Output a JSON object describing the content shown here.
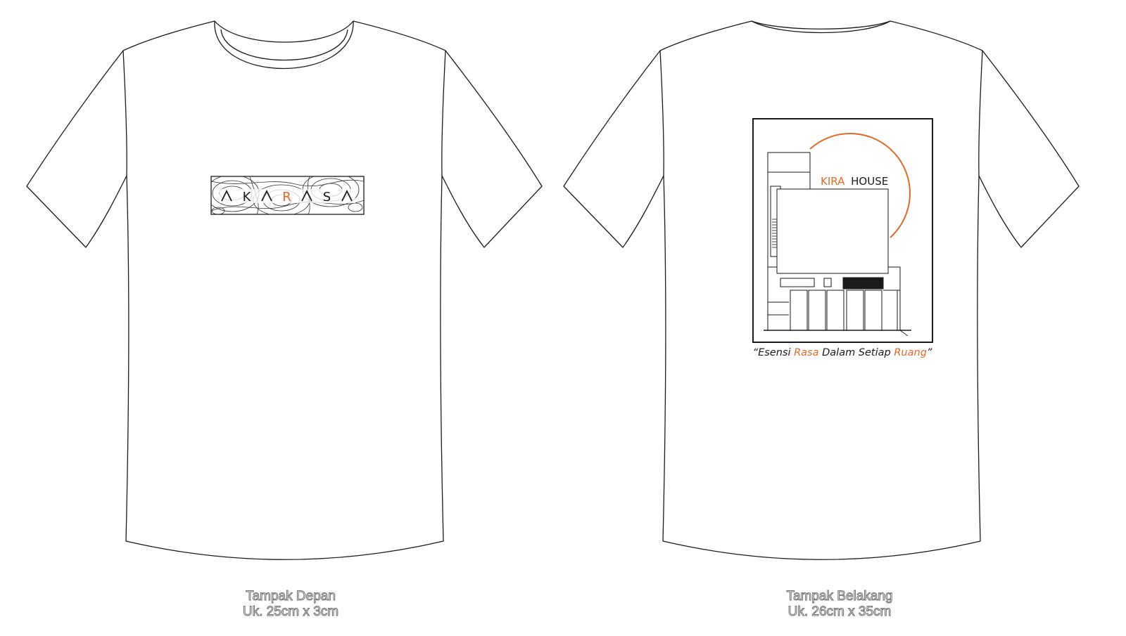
{
  "front": {
    "logo_letters": [
      "A",
      "K",
      "A",
      "R",
      "A",
      "S",
      "A"
    ],
    "logo_highlight_index": 3,
    "caption_title": "Tampak Depan",
    "caption_size": "Uk. 25cm x 3cm"
  },
  "back": {
    "brand_accent": "KIRA",
    "brand_rest": "HOUSE",
    "tagline_parts": [
      "“Esensi ",
      "Rasa",
      " Dalam Setiap ",
      "Ruang",
      "”"
    ],
    "caption_title": "Tampak Belakang",
    "caption_size": "Uk. 26cm x 35cm"
  },
  "colors": {
    "accent": "#e06a2a",
    "outline": "#1a1a1a",
    "caption": "#6f6f6f"
  }
}
